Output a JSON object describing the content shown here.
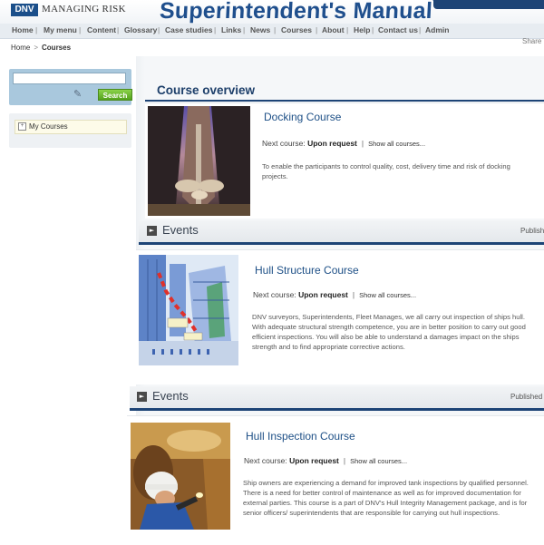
{
  "header": {
    "logo_abbr": "DNV",
    "logo_text": "MANAGING RISK",
    "app_title": "Superintendent's Manual",
    "app_title_mark": "TM"
  },
  "nav": {
    "items": [
      {
        "label": "Home"
      },
      {
        "label": "My menu"
      },
      {
        "label": "Content"
      },
      {
        "label": "Glossary"
      },
      {
        "label": "Case studies"
      },
      {
        "label": "Links"
      },
      {
        "label": "News"
      },
      {
        "label": "Courses"
      },
      {
        "label": "About"
      },
      {
        "label": "Help"
      },
      {
        "label": "Contact us"
      },
      {
        "label": "Admin"
      }
    ],
    "share_label": "Share"
  },
  "breadcrumb": {
    "home": "Home",
    "current": "Courses"
  },
  "sidebar": {
    "search_placeholder": "",
    "search_button": "Search",
    "mycourses_label": "My Courses"
  },
  "main": {
    "section_title": "Course overview",
    "next_course_prefix": "Next course:",
    "show_all_label": "Show all courses...",
    "events_label": "Events",
    "published_label": "Published",
    "courses": [
      {
        "title": "Docking Course",
        "next_course": "Upon request",
        "description": "To enable the participants to control quality, cost, delivery time and risk of docking projects."
      },
      {
        "title": "Hull Structure Course",
        "next_course": "Upon request",
        "description": "DNV surveyors, Superintendents, Fleet Manages, we all carry out inspection of ships hull. With adequate structural strength competence, you are in better position to carry out good efficient inspections. You will also be able to understand a damages impact on the ships strength and to find appropriate corrective actions."
      },
      {
        "title": "Hull Inspection Course",
        "next_course": "Upon request",
        "description": "Ship owners are experiencing a demand for improved tank inspections by qualified personnel. There is a need for better control of maintenance as well as for improved documentation for external parties. This course is a part of DNV's Hull Integrity Management package, and is for senior officers/ superintendents that are responsible for carrying out hull inspections."
      }
    ]
  }
}
